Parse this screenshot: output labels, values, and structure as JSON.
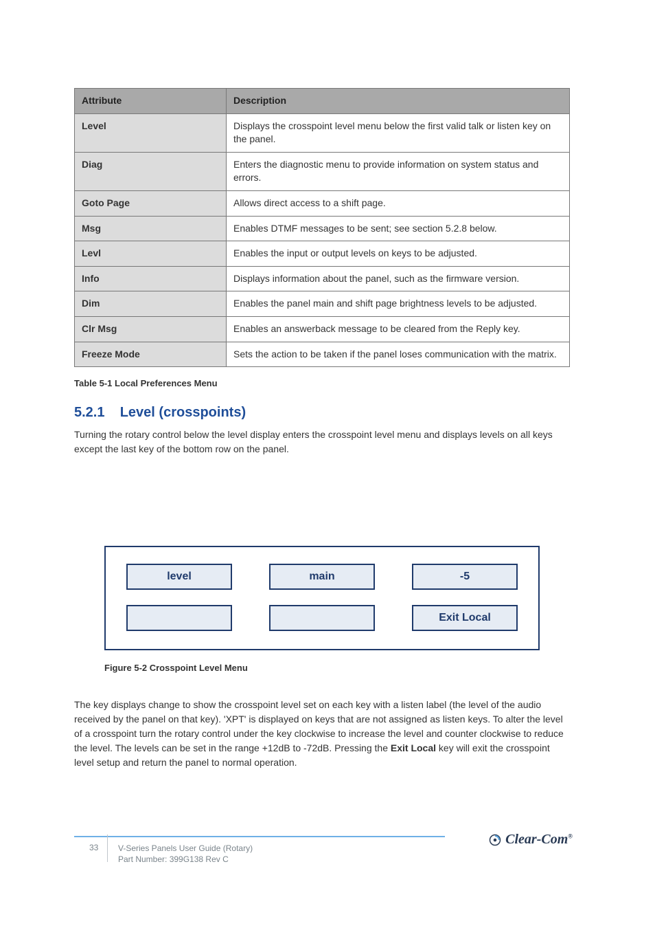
{
  "table": {
    "head": {
      "c1": "Attribute",
      "c2": "Description"
    },
    "rows": [
      {
        "label": "Level",
        "desc": "Displays the crosspoint level menu below the first valid talk or listen key on the panel."
      },
      {
        "label": "Diag",
        "desc": "Enters the diagnostic menu to provide information on system status and errors."
      },
      {
        "label": "Goto Page",
        "desc": "Allows direct access to a shift page."
      },
      {
        "label": "Msg",
        "desc": "Enables DTMF messages to be sent; see section 5.2.8 below."
      },
      {
        "label": "Levl",
        "desc": "Enables the input or output levels on keys to be adjusted."
      },
      {
        "label": "Info",
        "desc": "Displays information about the panel, such as the firmware version."
      },
      {
        "label": "Dim",
        "desc": "Enables the panel main and shift page brightness levels to be adjusted."
      },
      {
        "label": "Clr Msg",
        "desc": "Enables an answerback message to be cleared from the Reply key."
      },
      {
        "label": "Freeze Mode",
        "desc": "Sets the action to be taken if the panel loses communication with the matrix."
      }
    ],
    "caption": "Table 5-1 Local Preferences Menu"
  },
  "section": {
    "num": "5.2.1",
    "title": "Level (crosspoints)",
    "para1": "Turning the rotary control below the level display enters the crosspoint level menu and displays levels on all keys except the last key of the bottom row on the panel.",
    "figure": {
      "r1c1": "level",
      "r1c2": "main",
      "r1c3": "-5",
      "r2c1": "",
      "r2c2": "",
      "r2c3": "Exit Local",
      "caption": "Figure 5-2 Crosspoint Level Menu"
    },
    "para2_a": "The key displays change to show the crosspoint level set on each key with a listen label (the level of the audio received by the panel on that key). 'XPT' is displayed on keys that are not assigned as listen keys. To alter the level of a crosspoint turn the rotary control under the key clockwise to increase the level and counter clockwise to reduce the level. The levels can be set in the range +12dB to -72dB. Pressing the ",
    "para2_b": " key will exit the crosspoint level setup and return the panel to normal operation.",
    "exit_label": "Exit Local"
  },
  "footer": {
    "page": "33",
    "line1": "V-Series Panels User Guide (Rotary)",
    "line2": "Part Number: 399G138 Rev C",
    "brand": "Clear-Com"
  }
}
